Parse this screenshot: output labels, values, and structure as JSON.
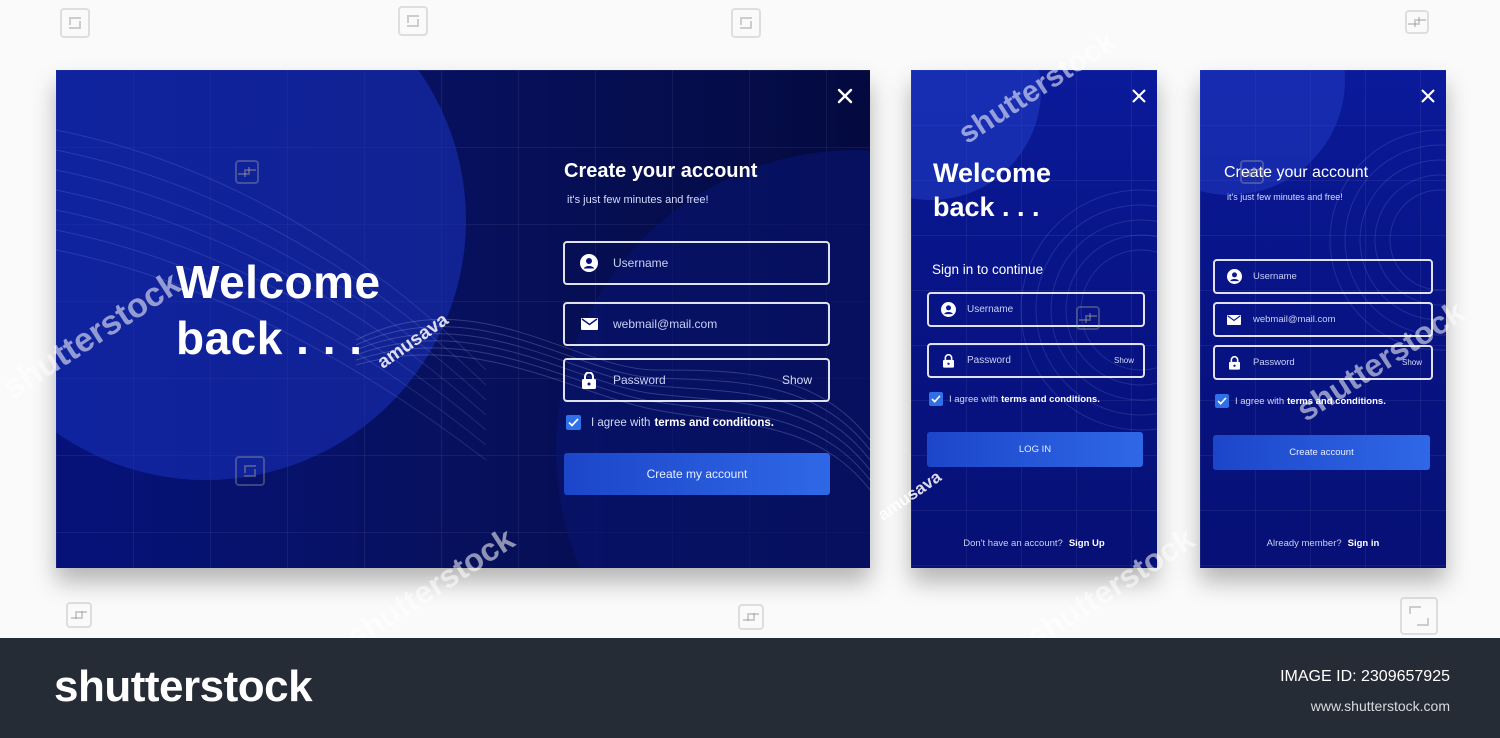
{
  "desktop_signup": {
    "welcome_line1": "Welcome",
    "welcome_line2": "back . . .",
    "title": "Create your account",
    "subtitle": "it's just few minutes and free!",
    "username_placeholder": "Username",
    "email_placeholder": "webmail@mail.com",
    "password_placeholder": "Password",
    "show_label": "Show",
    "agree_prefix": "I agree with",
    "agree_link": "terms and conditions.",
    "submit_label": "Create my account"
  },
  "mobile_login": {
    "welcome_line1": "Welcome",
    "welcome_line2": "back . . .",
    "title": "Sign in to continue",
    "username_placeholder": "Username",
    "password_placeholder": "Password",
    "show_label": "Show",
    "agree_prefix": "I agree with",
    "agree_link": "terms and conditions.",
    "submit_label": "LOG IN",
    "footer_text": "Don't have an account?",
    "footer_link": "Sign Up"
  },
  "mobile_signup": {
    "title": "Create your account",
    "subtitle": "it's just few minutes and free!",
    "username_placeholder": "Username",
    "email_placeholder": "webmail@mail.com",
    "password_placeholder": "Password",
    "show_label": "Show",
    "agree_prefix": "I agree with",
    "agree_link": "terms and conditions.",
    "submit_label": "Create account",
    "footer_text": "Already member?",
    "footer_link": "Sign in"
  },
  "icons": {
    "close": "close-icon",
    "user": "user-icon",
    "mail": "mail-icon",
    "lock": "lock-icon",
    "checkbox": "check-icon"
  },
  "colors": {
    "card_dark": "#040a3f",
    "card_blue": "#081486",
    "button_accent": "#2f68e6",
    "checkbox_accent": "#2f6fe8",
    "stock_bar": "#262c36"
  },
  "watermark": {
    "brand": "shutterstock",
    "author": "amusava",
    "image_id_label": "IMAGE ID: 2309657925",
    "site_url": "www.shutterstock.com"
  }
}
